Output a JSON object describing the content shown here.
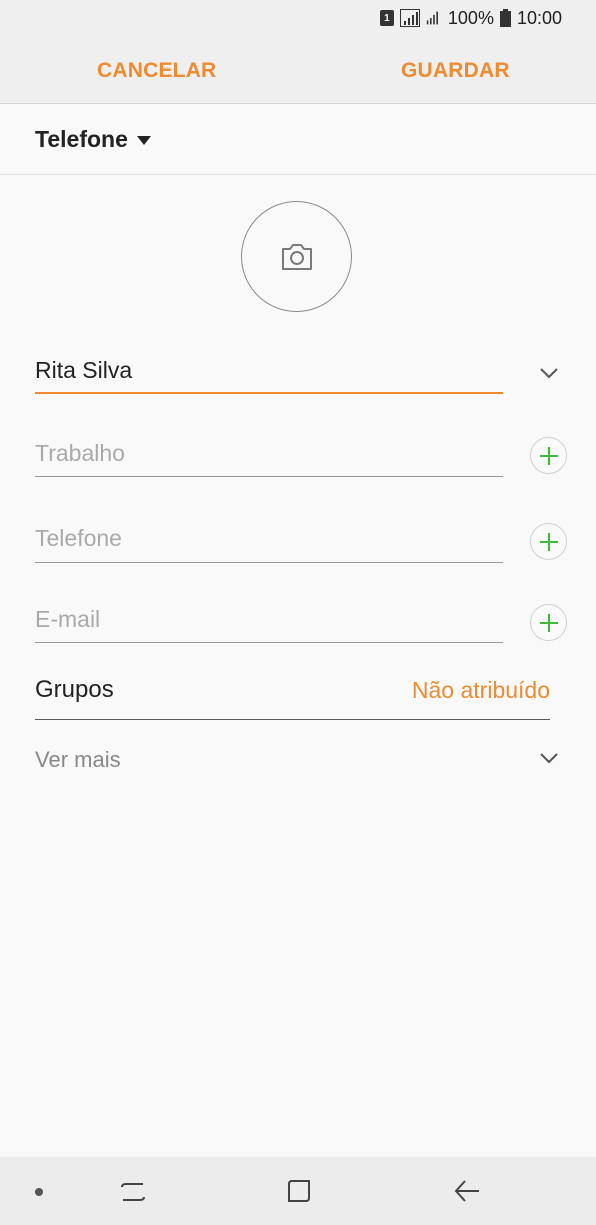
{
  "status_bar": {
    "sim_label": "1",
    "battery": "100%",
    "time": "10:00"
  },
  "header": {
    "cancel_label": "CANCELAR",
    "save_label": "GUARDAR"
  },
  "account": {
    "label": "Telefone"
  },
  "form": {
    "name_value": "Rita Silva",
    "organization_placeholder": "Trabalho",
    "phone_placeholder": "Telefone",
    "email_placeholder": "E-mail",
    "groups_label": "Grupos",
    "groups_value": "Não atribuído",
    "view_more_label": "Ver mais"
  },
  "icons": {
    "photo": "camera-icon",
    "expand": "chevron-down-icon",
    "add": "plus-icon",
    "nav_recents": "recents-icon",
    "nav_home": "home-icon",
    "nav_back": "back-icon"
  },
  "colors": {
    "accent": "#f08a2e",
    "add_green": "#3dbb3d"
  }
}
